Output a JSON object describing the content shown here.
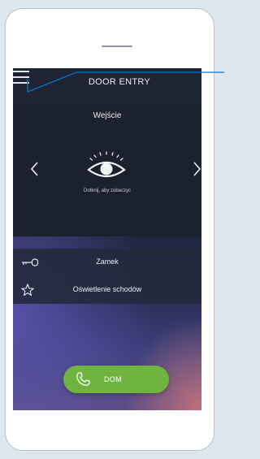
{
  "header": {
    "title": "DOOR ENTRY"
  },
  "camera": {
    "label": "Wejście",
    "hint": "Dotknij, aby zobaczyć"
  },
  "actions": [
    {
      "label": "Zamek",
      "icon": "key-icon"
    },
    {
      "label": "Oświetlenie schodów",
      "icon": "star-icon"
    }
  ],
  "call": {
    "label": "DOM",
    "icon": "phone-icon"
  },
  "colors": {
    "accent": "#6fb43f",
    "callout": "#0a74c6"
  }
}
